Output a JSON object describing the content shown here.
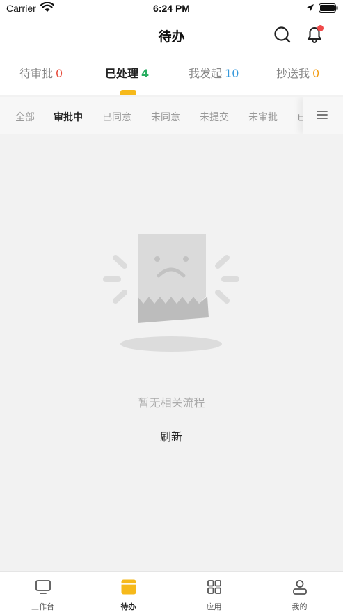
{
  "status_bar": {
    "carrier": "Carrier",
    "time": "6:24 PM"
  },
  "header": {
    "title": "待办"
  },
  "tabs": [
    {
      "label": "待审批",
      "count": "0",
      "count_color": "#e74c3c"
    },
    {
      "label": "已处理",
      "count": "4",
      "count_color": "#27ae60",
      "active": true
    },
    {
      "label": "我发起",
      "count": "10",
      "count_color": "#3498db"
    },
    {
      "label": "抄送我",
      "count": "0",
      "count_color": "#f39c12"
    }
  ],
  "filters": [
    {
      "label": "全部"
    },
    {
      "label": "审批中",
      "active": true
    },
    {
      "label": "已同意"
    },
    {
      "label": "未同意"
    },
    {
      "label": "未提交"
    },
    {
      "label": "未审批"
    },
    {
      "label": "已"
    }
  ],
  "empty_state": {
    "message": "暂无相关流程",
    "refresh_label": "刷新"
  },
  "bottom_nav": [
    {
      "label": "工作台",
      "icon": "monitor-icon"
    },
    {
      "label": "待办",
      "icon": "todo-icon",
      "active": true
    },
    {
      "label": "应用",
      "icon": "grid-icon"
    },
    {
      "label": "我的",
      "icon": "user-icon"
    }
  ],
  "colors": {
    "accent": "#f6b91a",
    "notification": "#f04a4a"
  }
}
